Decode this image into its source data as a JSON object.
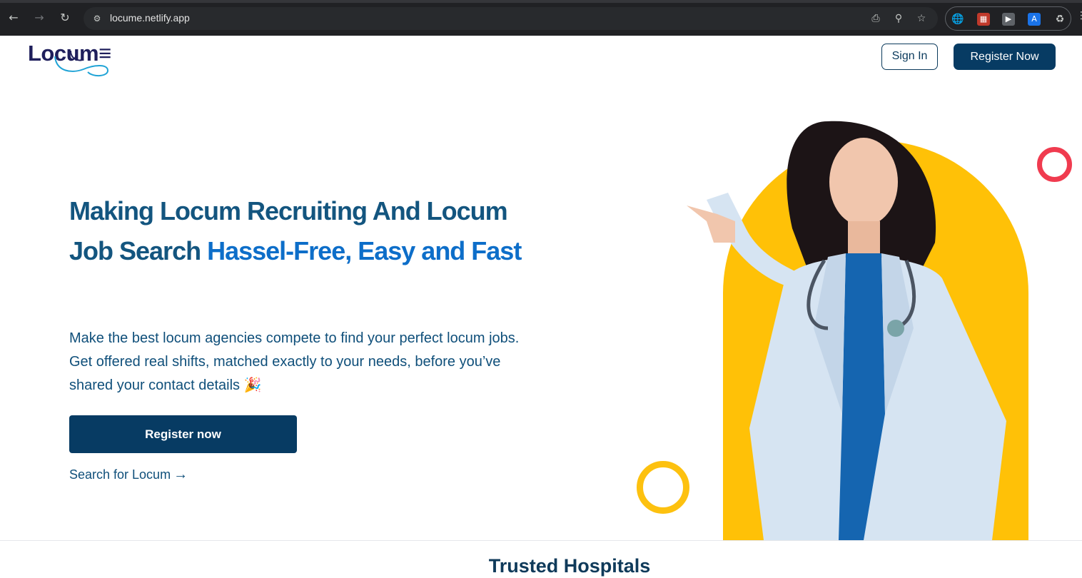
{
  "browser": {
    "url": "locume.netlify.app"
  },
  "header": {
    "logo_text": "Locum≡",
    "signin_label": "Sign In",
    "register_label": "Register Now"
  },
  "hero": {
    "title_part1": "Making Locum Recruiting And Locum Job Search ",
    "title_accent": "Hassel-Free, Easy and Fast",
    "subtitle": "Make the best locum agencies compete to find your perfect locum jobs. Get offered real shifts, matched exactly to your needs, before you’ve shared your contact details 🎉",
    "cta_label": "Register now",
    "search_link_label": "Search for Locum",
    "search_arrow": "→"
  },
  "trusted": {
    "title": "Trusted Hospitals"
  },
  "colors": {
    "primary_dark": "#073b63",
    "title_blue": "#13557f",
    "accent_blue": "#0d6ec9",
    "arch_yellow": "#ffc107",
    "ring_red": "#f03b4f"
  }
}
